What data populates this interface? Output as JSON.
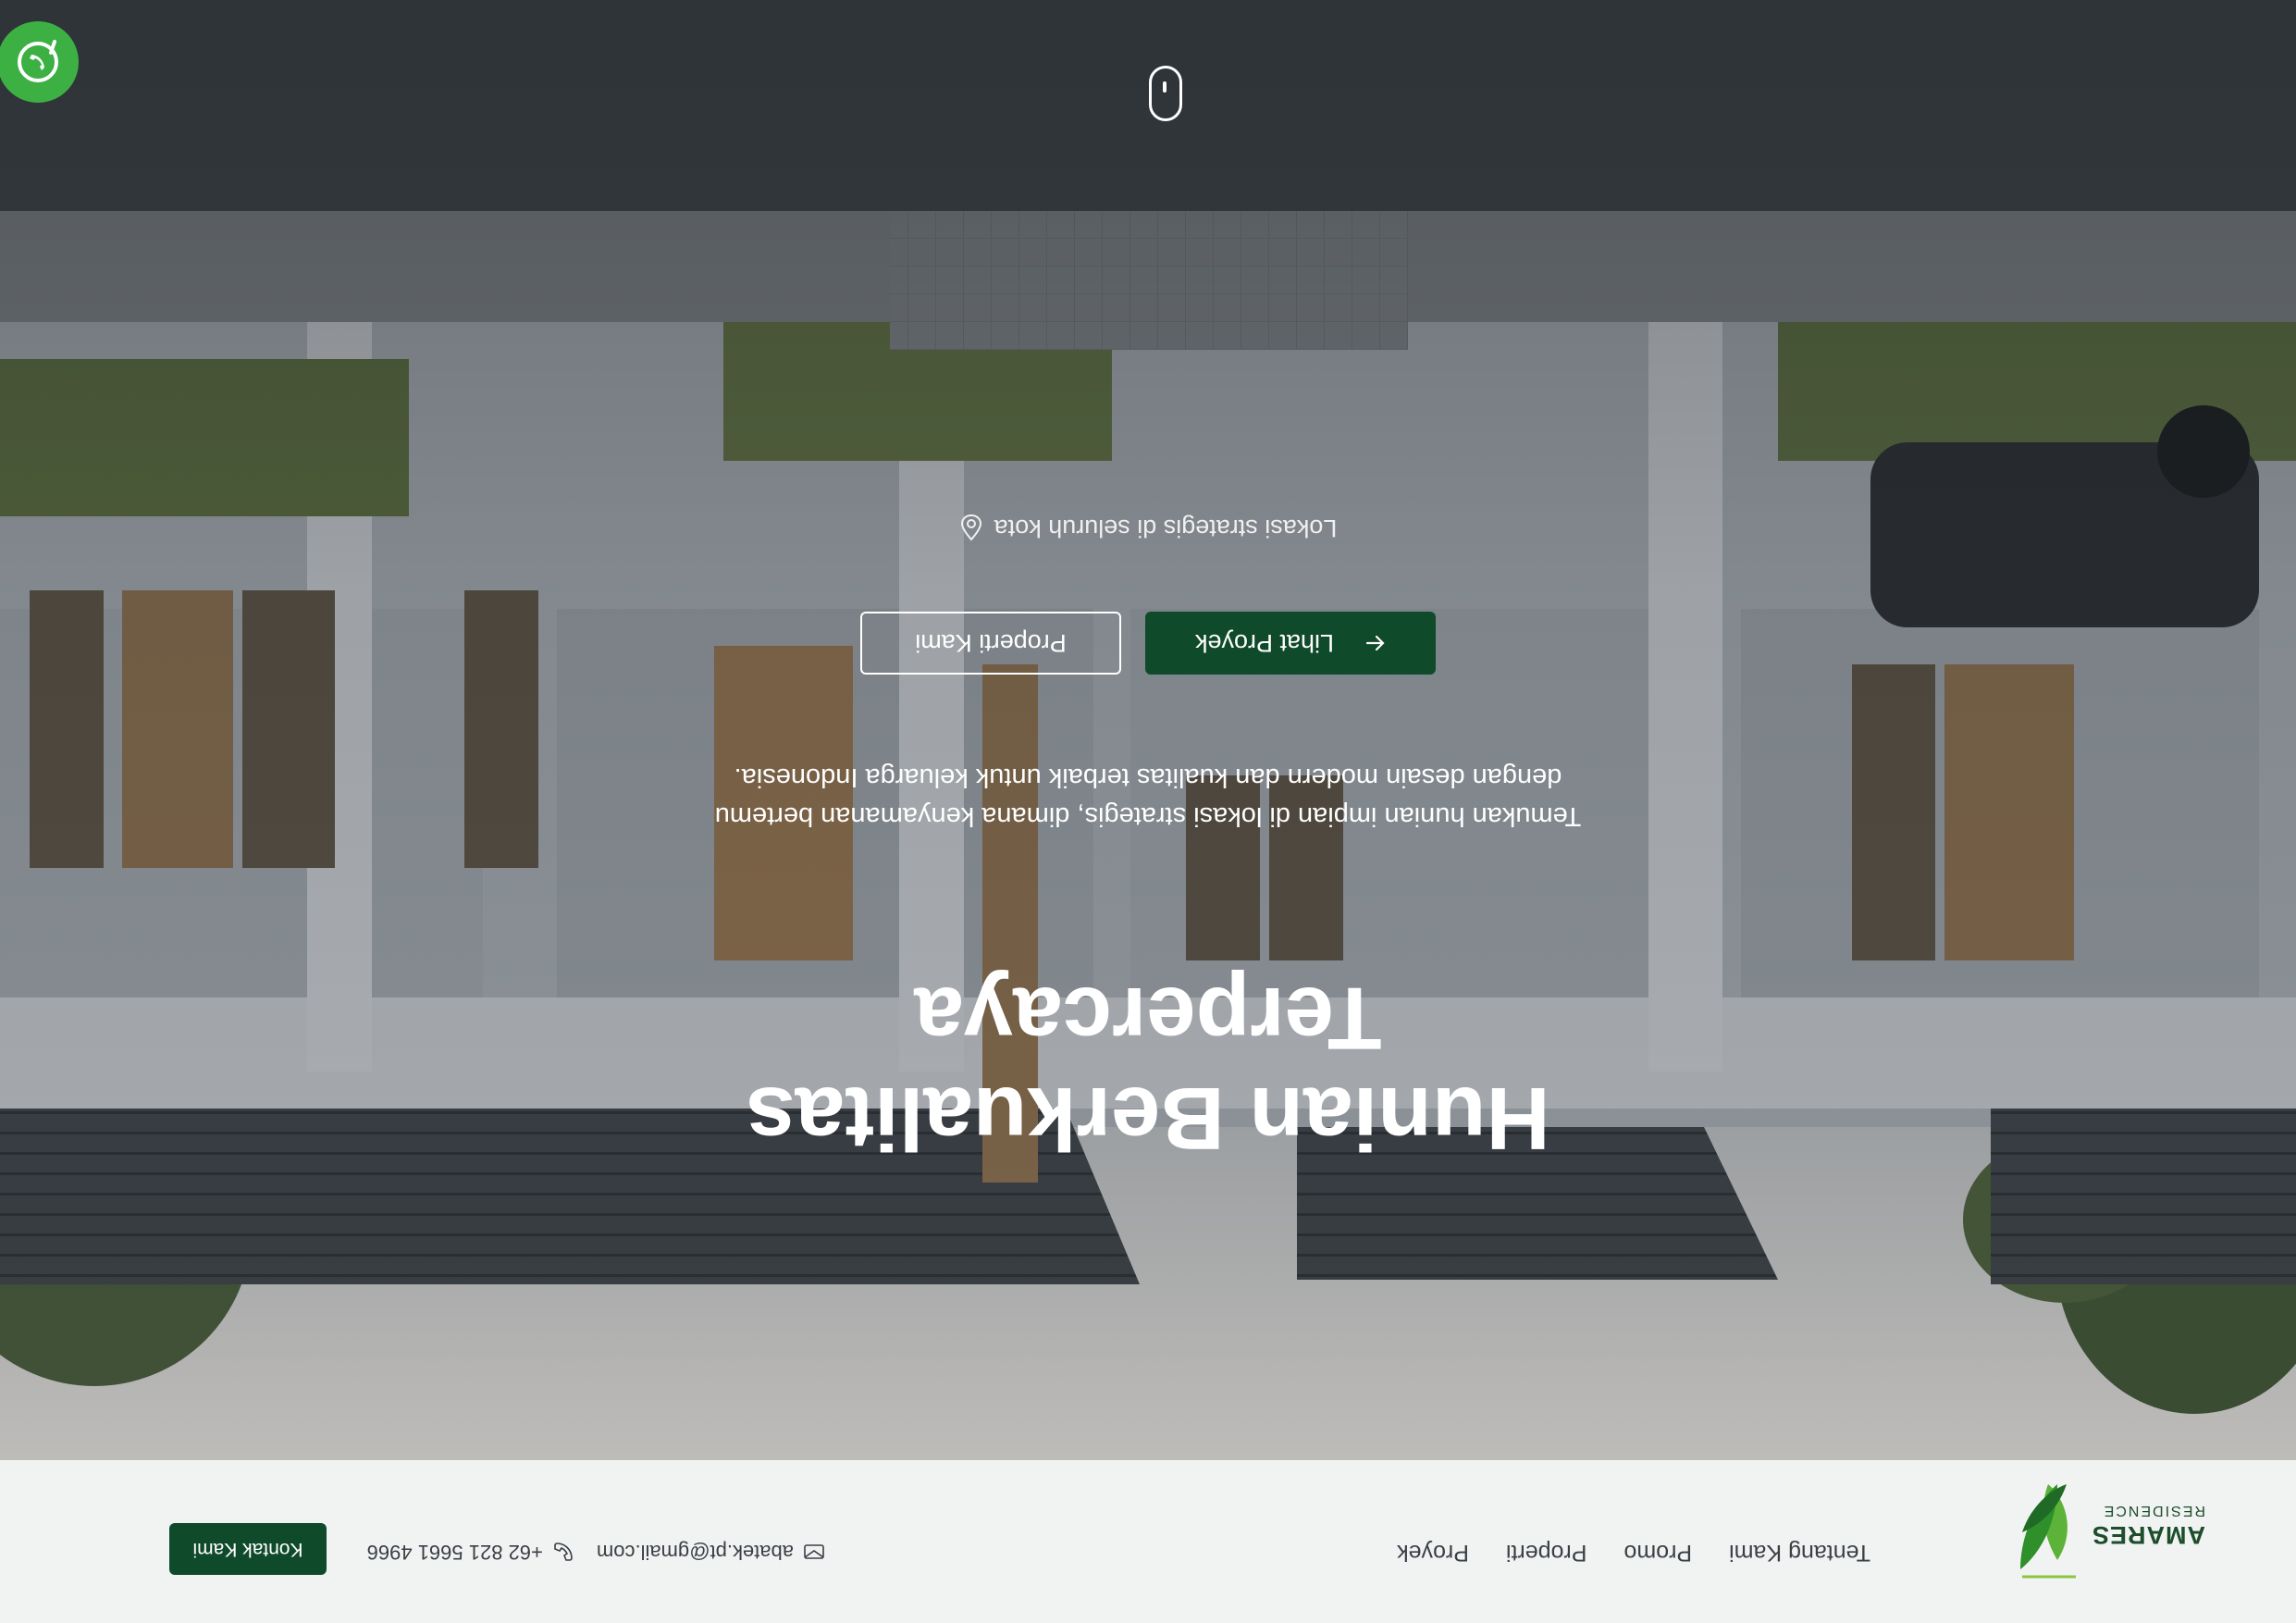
{
  "brand": {
    "name": "AMARES",
    "tagline": "RESIDENCE"
  },
  "nav": {
    "links": [
      "Proyek",
      "Properti",
      "Promo",
      "Tentang Kami"
    ]
  },
  "contact": {
    "phone": "+62 821 5661 4966",
    "email": "abatek.pt@gmail.com",
    "cta_label": "Kontak Kami"
  },
  "hero": {
    "title_line1": "Hunian Berkualitas",
    "title_line2": "Terpercaya",
    "subtitle_line1": "Temukan hunian impian di lokasi strategis, dimana kenyamanan bertemu",
    "subtitle_line2": "dengan desain modern dan kualitas terbaik untuk keluarga Indonesia.",
    "primary_button": "Lihat Proyek",
    "secondary_button": "Properti Kami",
    "location_note": "Lokasi strategis di seluruh kota"
  },
  "colors": {
    "accent": "#0f4a2a",
    "whatsapp": "#3cb043",
    "background": "#f1f3f3"
  }
}
